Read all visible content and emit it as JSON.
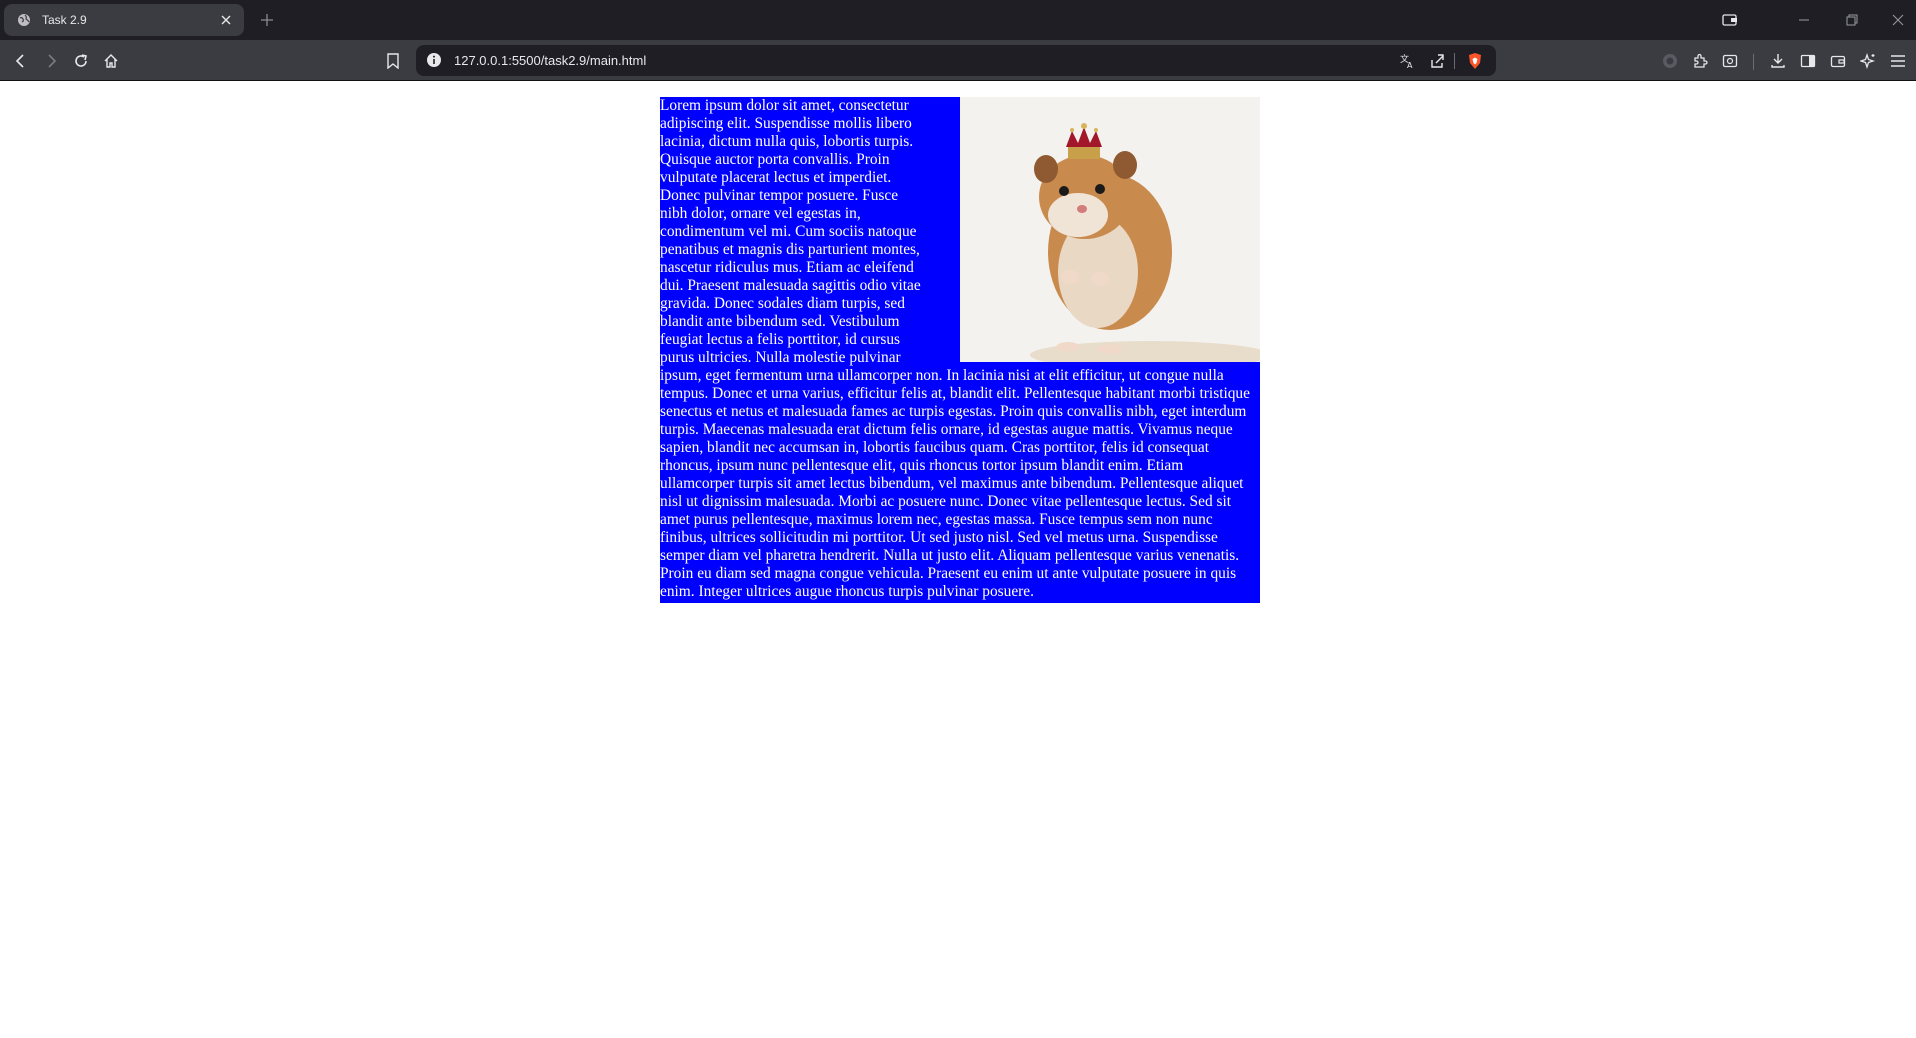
{
  "browser": {
    "tab": {
      "title": "Task 2.9",
      "favicon": "globe-icon"
    },
    "address_bar": {
      "url": "127.0.0.1:5500/task2.9/main.html"
    }
  },
  "page": {
    "paragraph": "Lorem ipsum dolor sit amet, consectetur adipiscing elit. Suspendisse mollis libero lacinia, dictum nulla quis, lobortis turpis. Quisque auctor porta convallis. Proin vulputate placerat lectus et imperdiet. Donec pulvinar tempor posuere. Fusce nibh dolor, ornare vel egestas in, condimentum vel mi. Cum sociis natoque penatibus et magnis dis parturient montes, nascetur ridiculus mus. Etiam ac eleifend dui. Praesent malesuada sagittis odio vitae gravida. Donec sodales diam turpis, sed blandit ante bibendum sed. Vestibulum feugiat lectus a felis porttitor, id cursus purus ultricies. Nulla molestie pulvinar ipsum, eget fermentum urna ullamcorper non. In lacinia nisi at elit efficitur, ut congue nulla tempus. Donec et urna varius, efficitur felis at, blandit elit. Pellentesque habitant morbi tristique senectus et netus et malesuada fames ac turpis egestas. Proin quis convallis nibh, eget interdum turpis. Maecenas malesuada erat dictum felis ornare, id egestas augue mattis. Vivamus neque sapien, blandit nec accumsan in, lobortis faucibus quam. Cras porttitor, felis id consequat rhoncus, ipsum nunc pellentesque elit, quis rhoncus tortor ipsum blandit enim. Etiam ullamcorper turpis sit amet lectus bibendum, vel maximus ante bibendum. Pellentesque aliquet nisl ut dignissim malesuada. Morbi ac posuere nunc. Donec vitae pellentesque lectus. Sed sit amet purus pellentesque, maximus lorem nec, egestas massa. Fusce tempus sem non nunc finibus, ultrices sollicitudin mi porttitor. Ut sed justo nisl. Sed vel metus urna. Suspendisse semper diam vel pharetra hendrerit. Nulla ut justo elit. Aliquam pellentesque varius venenatis. Proin eu diam sed magna congue vehicula. Praesent eu enim ut ante vulputate posuere in quis enim. Integer ultrices augue rhoncus turpis pulvinar posuere.",
    "image": "hamster-with-crown",
    "colors": {
      "content_background": "#0000ff",
      "content_text": "#ffffff"
    }
  }
}
